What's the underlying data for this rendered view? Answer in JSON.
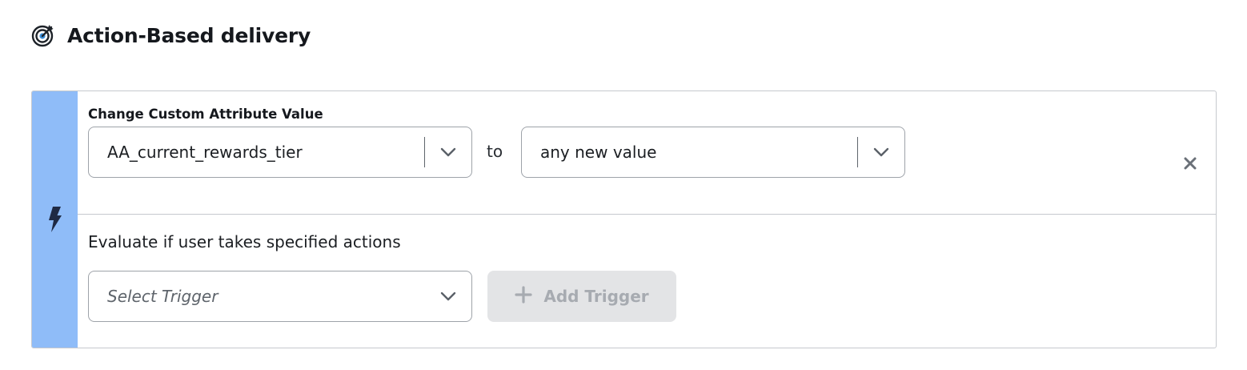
{
  "header": {
    "title": "Action-Based delivery",
    "icon": "target-icon"
  },
  "trigger_card": {
    "rail_icon": "lightning-bolt-icon",
    "rail_color": "#8fbcf8",
    "attribute_section": {
      "label": "Change Custom Attribute Value",
      "attribute_select": {
        "value": "AA_current_rewards_tier"
      },
      "connector": "to",
      "value_select": {
        "value": "any new value"
      },
      "remove_icon": "close-icon"
    },
    "evaluate_section": {
      "text": "Evaluate if user takes specified actions",
      "trigger_select": {
        "placeholder": "Select Trigger"
      },
      "add_trigger_button": {
        "label": "Add Trigger",
        "icon": "plus-icon",
        "disabled": true
      }
    }
  }
}
